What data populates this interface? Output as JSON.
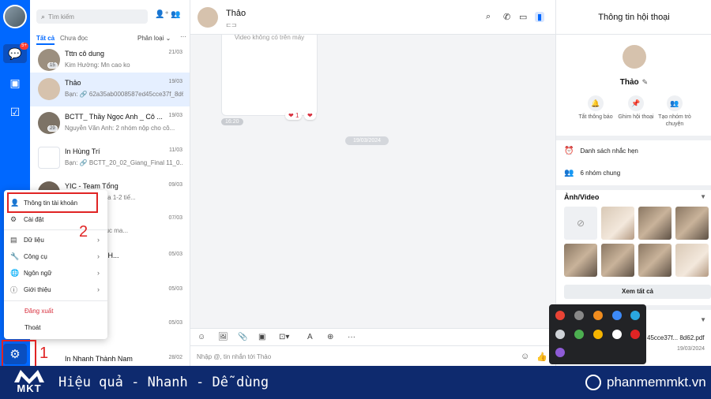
{
  "search": {
    "placeholder": "Tìm kiếm"
  },
  "filters": {
    "all": "Tất cả",
    "unread": "Chưa đọc",
    "sort": "Phân loại",
    "more": "···"
  },
  "nav": {
    "badge": "5+"
  },
  "conversations": [
    {
      "name": "Tttn cô dung",
      "time": "21/03",
      "msg": "Kim Hường: Mn cao ko",
      "count": "15"
    },
    {
      "name": "Thảo",
      "time": "19/03",
      "msg": "Bạn: 🔗 62a35ab0008587ed45cce37f_8d6...",
      "count": ""
    },
    {
      "name": "BCTT_ Thầy Ngọc Anh _ Cô ...",
      "time": "19/03",
      "msg": "Nguyễn Văn Anh: 2 nhóm nộp cho cô...",
      "count": "29"
    },
    {
      "name": "In Hùng Trí",
      "time": "11/03",
      "msg": "Bạn: 🔗 BCTT_20_02_Giang_Final 11_0...",
      "count": ""
    },
    {
      "name": "YIC - Team Tổng",
      "time": "09/03",
      "msg": "má được thi qua 1-2 tiế...",
      "count": ""
    },
    {
      "name": "p",
      "time": "07/03",
      "msg": "nghệ, Be tiếp tục ma...",
      "count": ""
    },
    {
      "name": "Thảo, Hoàng H...",
      "time": "05/03",
      "msg": "có nhóm",
      "count": ""
    },
    {
      "name": "",
      "time": "05/03",
      "msg": "căng lắm nhỉ",
      "count": ""
    },
    {
      "name": "",
      "time": "05/03",
      "msg": "xong rồi chị ạ",
      "count": ""
    },
    {
      "name": "In Nhanh Thành Nam",
      "time": "28/02",
      "msg": "",
      "count": ""
    }
  ],
  "menu": {
    "account": "Thông tin tài khoản",
    "settings": "Cài đặt",
    "data": "Dữ liệu",
    "tools": "Công cụ",
    "language": "Ngôn ngữ",
    "about": "Giới thiệu",
    "logout": "Đăng xuất",
    "quit": "Thoát"
  },
  "steps": {
    "one": "1",
    "two": "2"
  },
  "chat": {
    "name": "Thảo",
    "video_text": "Video không có trên máy",
    "msg_time": "16:20",
    "reaction": "1",
    "date_pill": "19/03/2024",
    "input_placeholder": "Nhập @, tin nhắn tới Thảo"
  },
  "info": {
    "title": "Thông tin hội thoại",
    "name": "Thảo",
    "actions": [
      {
        "label": "Tắt thông báo"
      },
      {
        "label": "Ghim hội thoại"
      },
      {
        "label": "Tạo nhóm trò chuyện"
      }
    ],
    "reminders": "Danh sách nhắc hẹn",
    "groups": "6 nhóm chung",
    "media_title": "Ảnh/Video",
    "see_all": "Xem tất cả",
    "file_name": "45cce37f... 8d62.pdf",
    "file_date": "19/03/2024"
  },
  "footer": {
    "brand": "MKT",
    "slogan": "Hiệu quả - Nhanh - Dễ dùng",
    "site": "phanmemmkt.vn"
  },
  "colors": {
    "primary": "#0068ff",
    "footer": "#0e2a6e",
    "highlight": "#e02424"
  }
}
